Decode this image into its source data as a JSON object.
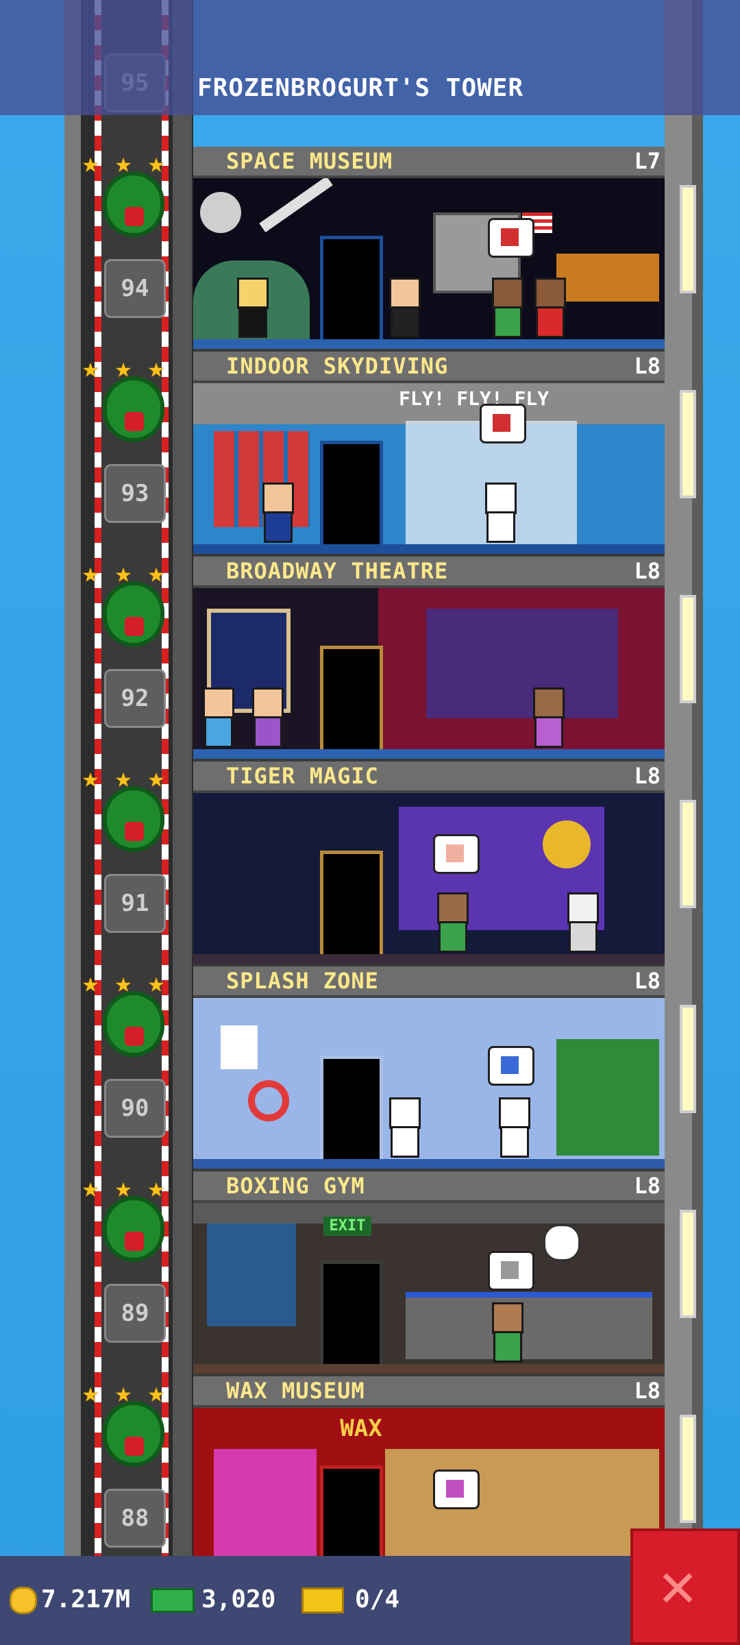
{
  "tower": {
    "title": "FROZENBROGURT'S TOWER"
  },
  "floors": [
    {
      "name": "SPACE MUSEUM",
      "level": "L7",
      "number": "94",
      "theme": "#0b0b1a"
    },
    {
      "name": "INDOOR SKYDIVING",
      "level": "L8",
      "number": "93",
      "theme": "#2d86c9",
      "sign": "FLY! FLY! FLY"
    },
    {
      "name": "BROADWAY THEATRE",
      "level": "L8",
      "number": "92",
      "theme": "#5a1326"
    },
    {
      "name": "TIGER MAGIC",
      "level": "L8",
      "number": "91",
      "theme": "#141a3a"
    },
    {
      "name": "SPLASH ZONE",
      "level": "L8",
      "number": "90",
      "theme": "#9ab6e8"
    },
    {
      "name": "BOXING GYM",
      "level": "L8",
      "number": "89",
      "theme": "#3b3330",
      "sign": "EXIT"
    },
    {
      "name": "WAX MUSEUM",
      "level": "L8",
      "number": "88",
      "theme": "#a01012",
      "sign": "WAX"
    }
  ],
  "top_partial_floor": {
    "number": "95"
  },
  "hud": {
    "coins": "7.217M",
    "bux": "3,020",
    "tickets": "0/4"
  },
  "icons": {
    "coin": "coin-icon",
    "bux": "cash-icon",
    "tickets": "ticket-icon",
    "close": "close-icon",
    "star": "star-icon",
    "wreath": "wreath-icon"
  },
  "colors": {
    "close_button": "#d81d2a",
    "floor_name": "#ffe88a",
    "hud_bg": "#3e4872"
  }
}
